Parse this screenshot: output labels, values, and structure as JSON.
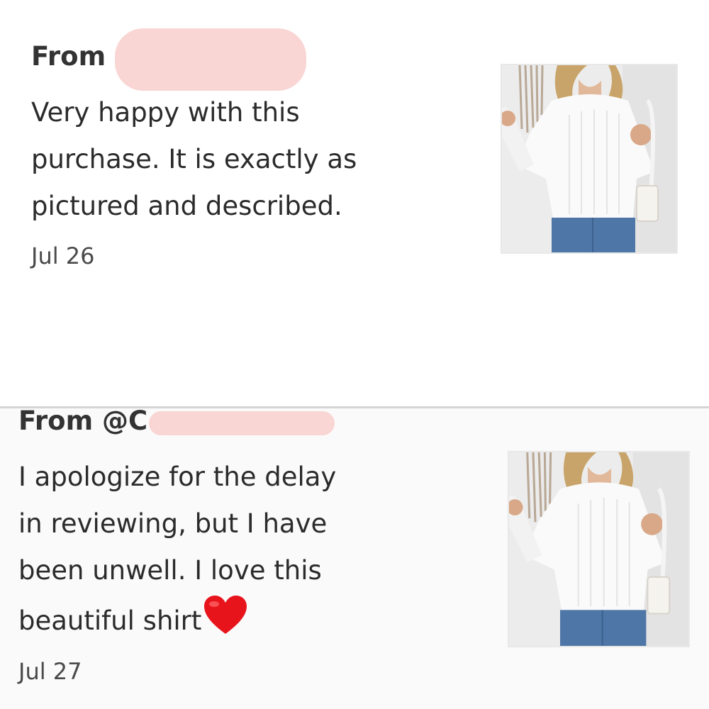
{
  "reviews": [
    {
      "from_label": "From",
      "body_lines": [
        "Very happy with this",
        "purchase. It is exactly as",
        "pictured and described."
      ],
      "date": "Jul 26",
      "thumbnail": "white-knit-sweater-photo"
    },
    {
      "from_label": "From @C",
      "body_lines": [
        "I apologize for the delay",
        "in reviewing, but I have",
        "been unwell. I love this",
        "beautiful shirt"
      ],
      "emoji": "heart-emoji",
      "date": "Jul 27",
      "thumbnail": "white-knit-sweater-photo"
    }
  ],
  "colors": {
    "redaction": "#f9d6d4",
    "heart": "#e8141c",
    "text": "#2b2b2b"
  }
}
